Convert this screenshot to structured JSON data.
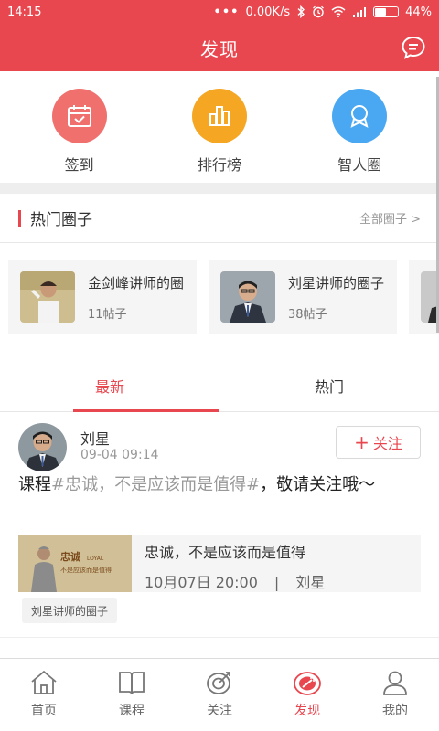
{
  "status_bar": {
    "time": "14:15",
    "network_speed": "0.00K/s",
    "battery": "44%",
    "battery_level": 0.44
  },
  "header": {
    "title": "发现",
    "message_icon": "chat-bubble-icon"
  },
  "quick_actions": [
    {
      "label": "签到",
      "icon": "calendar-check-icon",
      "color": "#f0706e"
    },
    {
      "label": "排行榜",
      "icon": "bar-chart-icon",
      "color": "#f5a623"
    },
    {
      "label": "智人圈",
      "icon": "ring-icon",
      "color": "#4aa8f2"
    }
  ],
  "hot_circles": {
    "title": "热门圈子",
    "view_all": "全部圈子 >",
    "cards": [
      {
        "name": "金剑峰讲师的圈子",
        "count": "11帖子"
      },
      {
        "name": "刘星讲师的圈子",
        "count": "38帖子"
      }
    ]
  },
  "tabs": [
    {
      "label": "最新",
      "active": true
    },
    {
      "label": "热门",
      "active": false
    }
  ],
  "post": {
    "author": "刘星",
    "time": "09-04 09:14",
    "follow_label": "关注",
    "text_prefix": "课程",
    "text_tag": "#忠诚，不是应该而是值得#",
    "text_suffix": "，敬请关注哦～",
    "course": {
      "title": "忠诚，不是应该而是值得",
      "date": "10月07日 20:00",
      "divider": "|",
      "teacher": "刘星",
      "thumb_title": "忠诚",
      "thumb_logo": "LOYAL",
      "thumb_sub": "不是应该而是值得"
    },
    "circle_tag": "刘星讲师的圈子"
  },
  "bottom_nav": [
    {
      "label": "首页",
      "icon": "home-icon",
      "active": false
    },
    {
      "label": "课程",
      "icon": "book-icon",
      "active": false
    },
    {
      "label": "关注",
      "icon": "target-icon",
      "active": false
    },
    {
      "label": "发现",
      "icon": "discover-icon",
      "active": true
    },
    {
      "label": "我的",
      "icon": "user-icon",
      "active": false
    }
  ],
  "colors": {
    "brand": "#e8474f",
    "text": "#333333",
    "muted": "#999999"
  }
}
